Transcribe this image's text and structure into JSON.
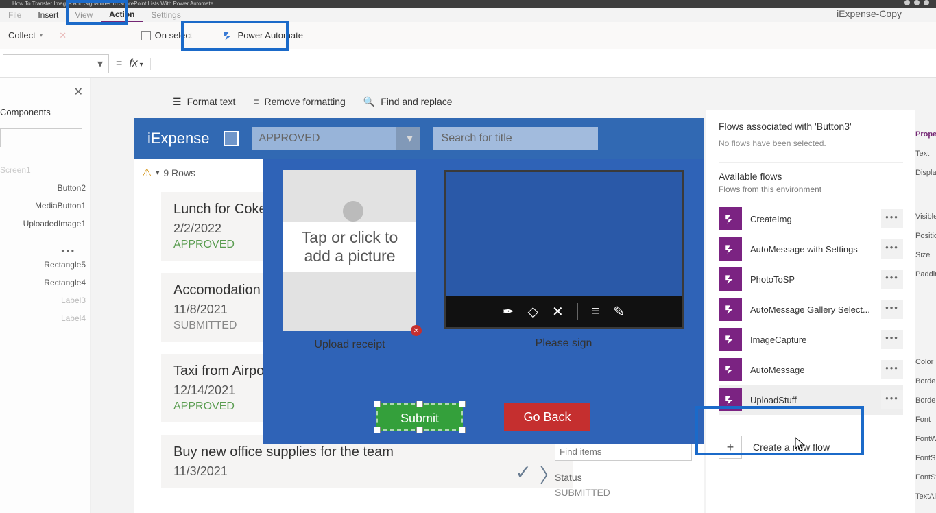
{
  "browser": {
    "tab_title": "How To Transfer Images And Signatures To SharePoint Lists With Power Automate"
  },
  "header": {
    "app_name": "iExpense-Copy"
  },
  "menu": {
    "file": "File",
    "insert": "Insert",
    "view": "View",
    "action": "Action",
    "settings": "Settings"
  },
  "cmd": {
    "collect": "Collect",
    "remove": "Remove",
    "onselect": "On select",
    "power_automate": "Power Automate"
  },
  "fmt": {
    "format": "Format text",
    "remove": "Remove formatting",
    "find": "Find and replace"
  },
  "tree": {
    "header": "Components",
    "items": [
      "Screen1",
      "Button2",
      "MediaButton1",
      "UploadedImage1",
      "Rectangle5",
      "Rectangle4",
      "Label3",
      "Label4"
    ]
  },
  "app": {
    "name": "iExpense",
    "dd_value": "APPROVED",
    "search_placeholder": "Search for title",
    "rows_label": "9 Rows"
  },
  "cards": [
    {
      "title": "Lunch for Coke",
      "date": "2/2/2022",
      "status": "APPROVED",
      "status_kind": "app"
    },
    {
      "title": "Accomodation",
      "date": "11/8/2021",
      "status": "SUBMITTED",
      "status_kind": "sub"
    },
    {
      "title": "Taxi from Airport",
      "date": "12/14/2021",
      "status": "APPROVED",
      "status_kind": "app"
    },
    {
      "title": "Buy new office supplies for the team",
      "date": "11/3/2021",
      "status": "",
      "status_kind": ""
    }
  ],
  "modal": {
    "tap_text": "Tap or click to add a picture",
    "upload_label": "Upload receipt",
    "sign_label": "Please sign",
    "submit": "Submit",
    "goback": "Go Back"
  },
  "detail": {
    "find_ph": "Find items",
    "status_lbl": "Status",
    "status_val": "SUBMITTED"
  },
  "right": {
    "title": "Flows associated with 'Button3'",
    "noflows": "No flows have been selected.",
    "available": "Available flows",
    "env": "Flows from this environment",
    "flows": [
      "CreateImg",
      "AutoMessage with Settings",
      "PhotoToSP",
      "AutoMessage Gallery Select...",
      "ImageCapture",
      "AutoMessage",
      "UploadStuff"
    ],
    "create": "Create a new flow"
  },
  "props": [
    "Properties",
    "Text",
    "Display",
    "Visible",
    "Position",
    "Size",
    "Padding",
    "Color",
    "Border",
    "BorderThickness",
    "Font",
    "FontWeight",
    "FontSize",
    "FontStyle",
    "TextAlign"
  ],
  "chart_data": null
}
